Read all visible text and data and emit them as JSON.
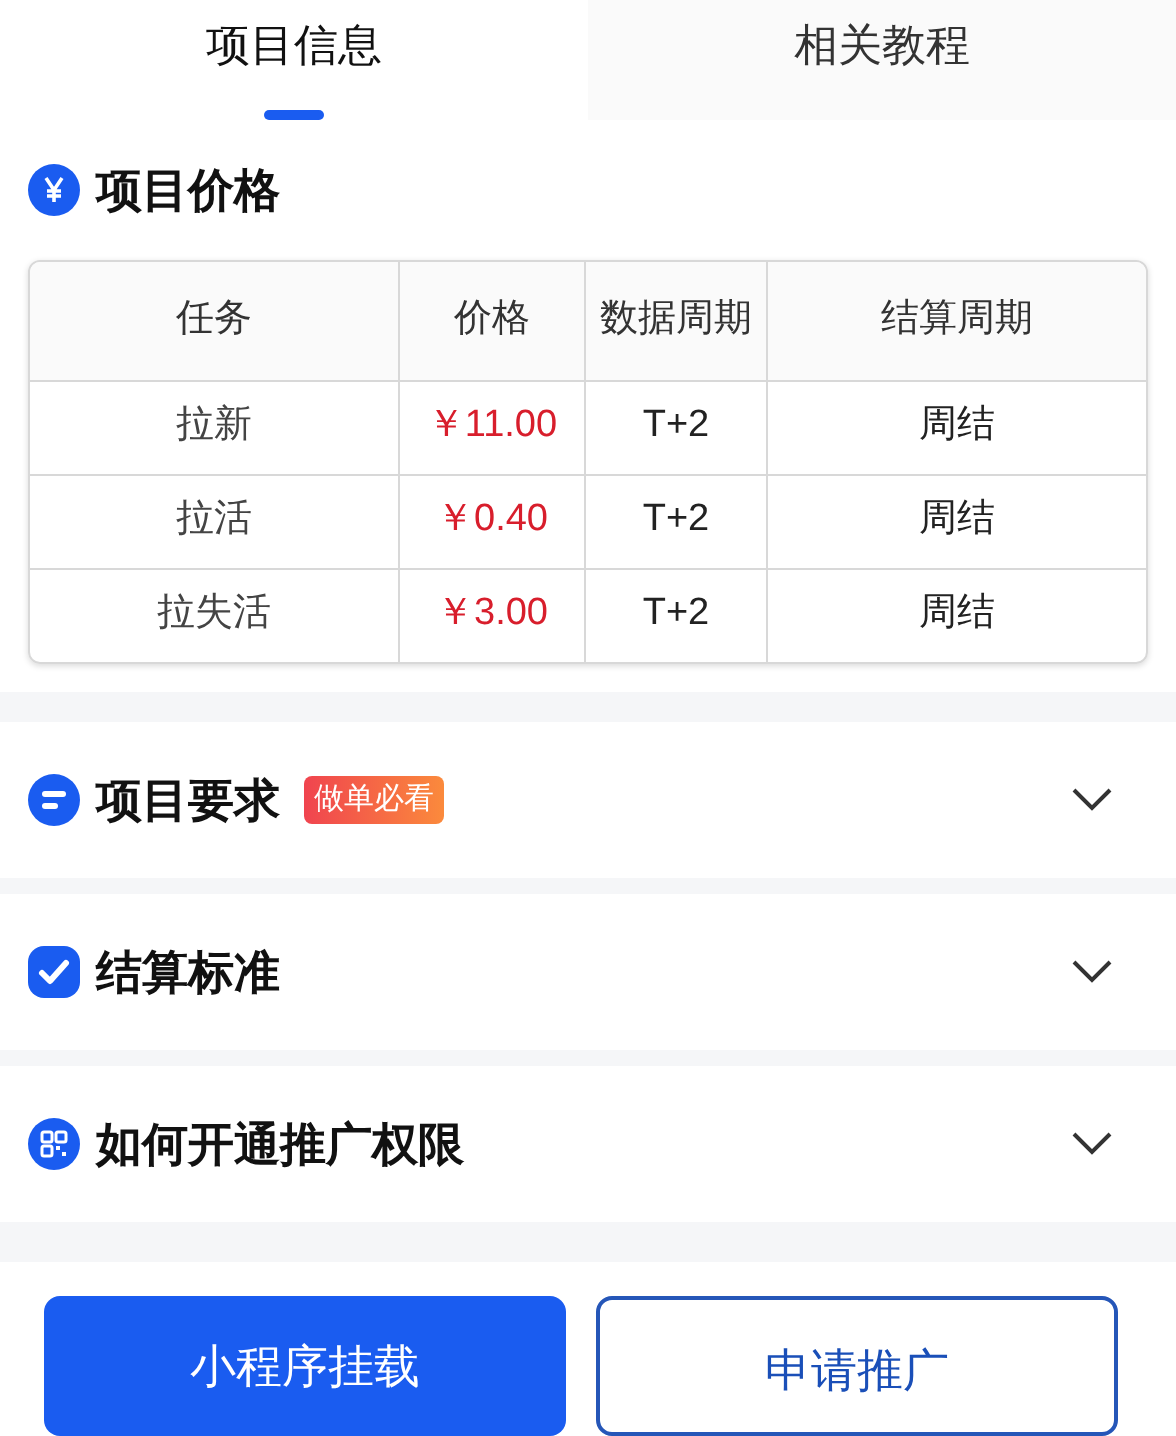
{
  "tabs": [
    {
      "label": "项目信息",
      "selected": true
    },
    {
      "label": "相关教程",
      "selected": false
    }
  ],
  "price_section": {
    "title": "项目价格",
    "table": {
      "columns": [
        "任务",
        "价格",
        "数据周期",
        "结算周期"
      ],
      "rows": [
        [
          "拉新",
          "￥11.00",
          "T+2",
          "周结"
        ],
        [
          "拉活",
          "￥0.40",
          "T+2",
          "周结"
        ],
        [
          "拉失活",
          "￥3.00",
          "T+2",
          "周结"
        ]
      ]
    }
  },
  "sections": [
    {
      "kind": "list",
      "title": "项目要求",
      "badge": "做单必看",
      "expanded": false
    },
    {
      "kind": "check",
      "title": "结算标准",
      "expanded": false
    },
    {
      "kind": "qr",
      "title": "如何开通推广权限",
      "expanded": false
    }
  ],
  "buttons": [
    {
      "label": "小程序挂载",
      "kind": "primary"
    },
    {
      "label": "申请推广",
      "kind": "outline"
    }
  ]
}
